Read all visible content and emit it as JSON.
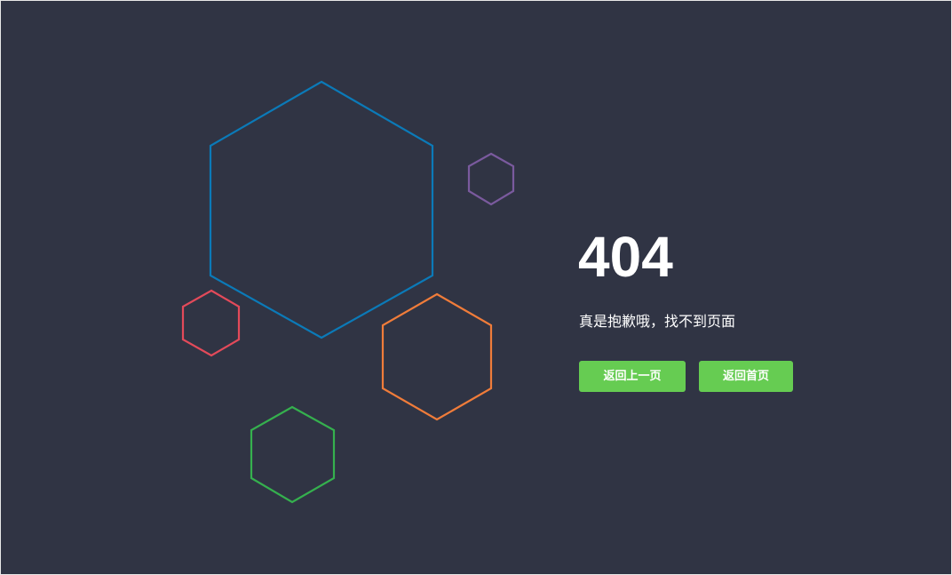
{
  "error": {
    "code": "404",
    "message": "真是抱歉哦，找不到页面"
  },
  "buttons": {
    "back_label": "返回上一页",
    "home_label": "返回首页",
    "color": "#66cc52"
  },
  "theme": {
    "background": "#303444",
    "hexagon_colors": {
      "large": "#0b7ab8",
      "small_purple": "#7a5a9e",
      "small_red": "#e34a5a",
      "orange": "#f07c3a",
      "green": "#35b04e"
    }
  }
}
